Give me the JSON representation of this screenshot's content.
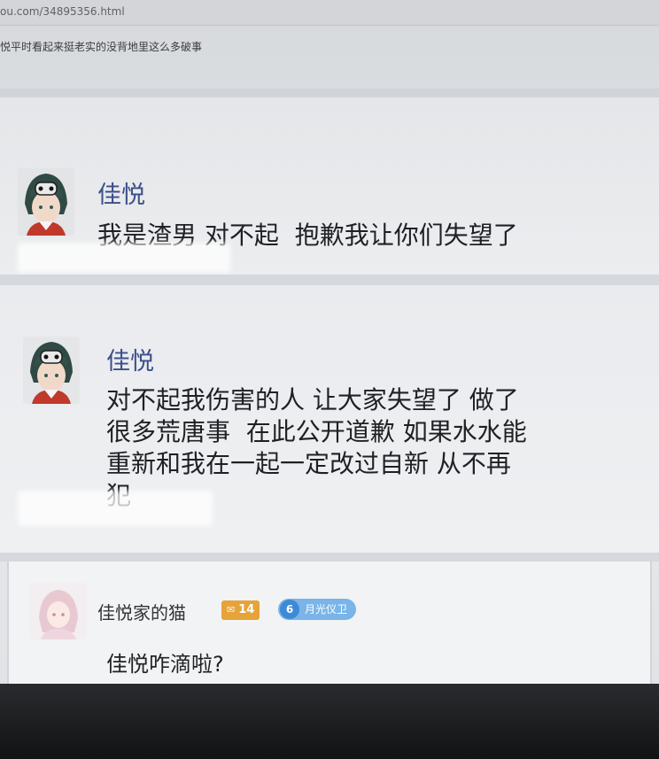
{
  "browser": {
    "url": "ou.com/34895356.html"
  },
  "thread": {
    "title": "悦平时看起来挺老实的没背地里这么多破事"
  },
  "posts": [
    {
      "username": "佳悦",
      "message": "我是渣男 对不起  抱歉我让你们失望了"
    },
    {
      "username": "佳悦",
      "message": "对不起我伤害的人 让大家失望了 做了\n很多荒唐事  在此公开道歉 如果水水能\n重新和我在一起一定改过自新 从不再\n犯"
    }
  ],
  "reply": {
    "username": "佳悦家的猫",
    "level": "14",
    "rank": "6",
    "title_badge": "月光仪卫",
    "text": "佳悦咋滴啦?"
  },
  "colors": {
    "username": "#3b4f8a",
    "level_badge": "#e6a33a",
    "title_badge": "#7ab4e8"
  }
}
